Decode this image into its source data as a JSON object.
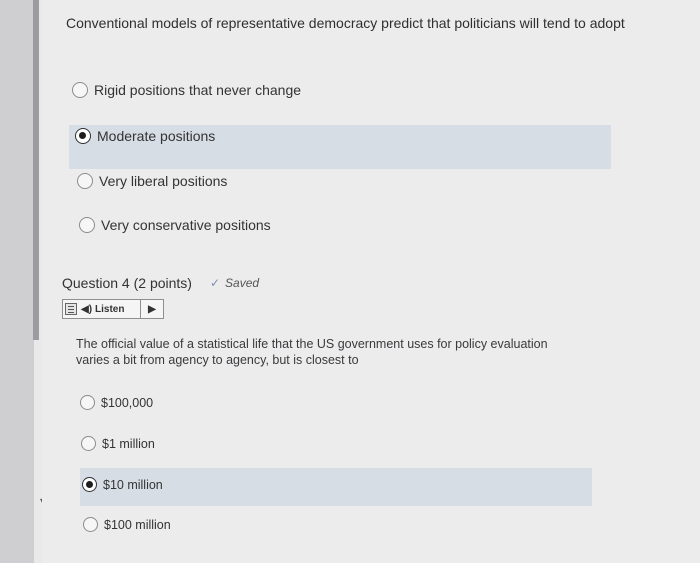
{
  "question3": {
    "prompt": "Conventional models of representative democracy predict that politicians will tend to adopt",
    "options": [
      {
        "label": "Rigid positions that never change",
        "selected": false
      },
      {
        "label": "Moderate positions",
        "selected": true
      },
      {
        "label": "Very liberal positions",
        "selected": false
      },
      {
        "label": "Very conservative positions",
        "selected": false
      }
    ]
  },
  "question4": {
    "title": "Question 4",
    "points": "(2 points)",
    "saved": "Saved",
    "listen_label": "Listen",
    "prompt": "The official value of a statistical life that the US government uses for policy evaluation varies a bit from agency to agency, but is closest to",
    "options": [
      {
        "label": "$100,000",
        "selected": false
      },
      {
        "label": "$1 million",
        "selected": false
      },
      {
        "label": "$10 million",
        "selected": true
      },
      {
        "label": "$100 million",
        "selected": false
      }
    ]
  },
  "colors": {
    "selected_background": "#d7dde5",
    "page_background": "#ececed"
  }
}
